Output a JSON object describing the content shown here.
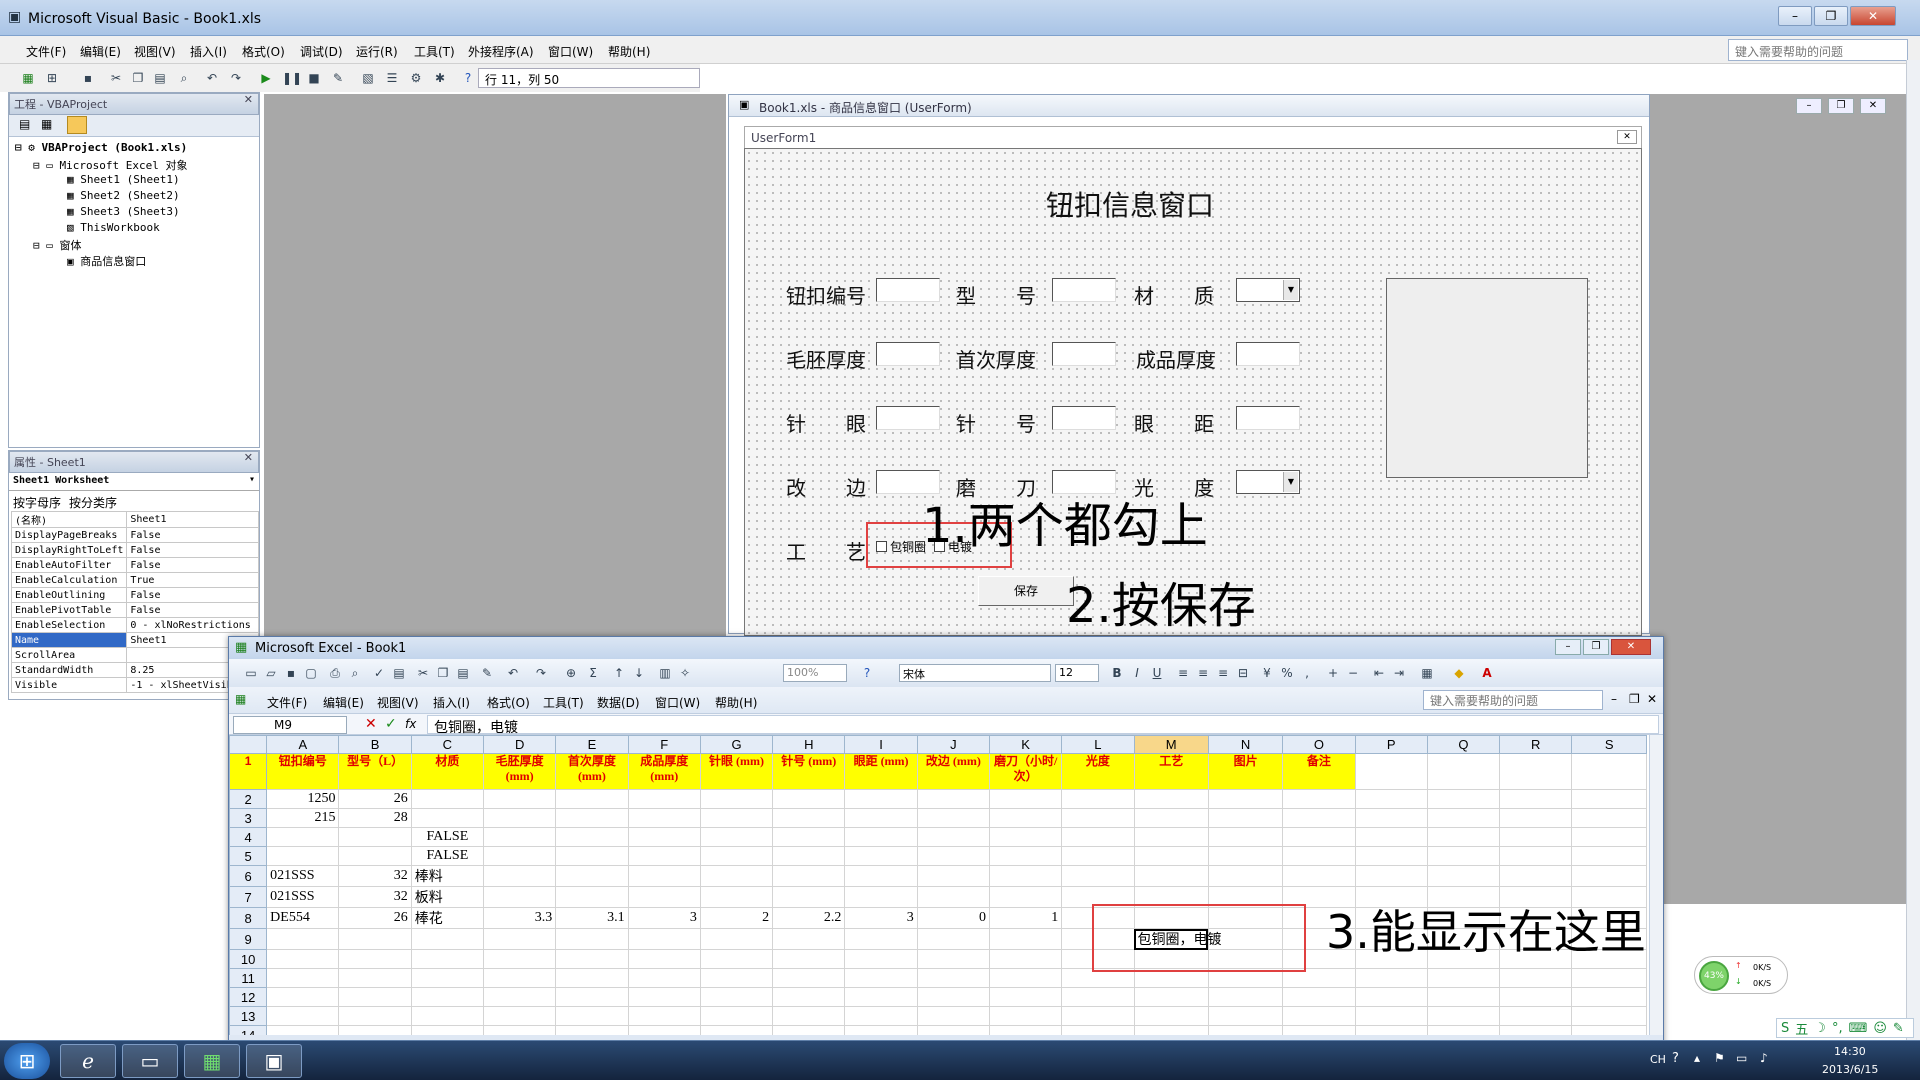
{
  "vbe": {
    "title": "Microsoft Visual Basic - Book1.xls",
    "menu": [
      "文件(F)",
      "编辑(E)",
      "视图(V)",
      "插入(I)",
      "格式(O)",
      "调试(D)",
      "运行(R)",
      "工具(T)",
      "外接程序(A)",
      "窗口(W)",
      "帮助(H)"
    ],
    "status": "行 11，列 50",
    "help_placeholder": "键入需要帮助的问题"
  },
  "project": {
    "title": "工程 - VBAProject",
    "tree": [
      "VBAProject (Book1.xls)",
      "Microsoft Excel 对象",
      "Sheet1 (Sheet1)",
      "Sheet2 (Sheet2)",
      "Sheet3 (Sheet3)",
      "ThisWorkbook",
      "窗体",
      "商品信息窗口"
    ]
  },
  "properties": {
    "title": "属性 - Sheet1",
    "object": "Sheet1 Worksheet",
    "tabs": [
      "按字母序",
      "按分类序"
    ],
    "rows": [
      [
        "(名称)",
        "Sheet1"
      ],
      [
        "DisplayPageBreaks",
        "False"
      ],
      [
        "DisplayRightToLeft",
        "False"
      ],
      [
        "EnableAutoFilter",
        "False"
      ],
      [
        "EnableCalculation",
        "True"
      ],
      [
        "EnableOutlining",
        "False"
      ],
      [
        "EnablePivotTable",
        "False"
      ],
      [
        "EnableSelection",
        "0 - xlNoRestrictions"
      ],
      [
        "Name",
        "Sheet1"
      ],
      [
        "ScrollArea",
        ""
      ],
      [
        "StandardWidth",
        "8.25"
      ],
      [
        "Visible",
        "-1 - xlSheetVisible"
      ]
    ]
  },
  "userform": {
    "window_title": "Book1.xls - 商品信息窗口 (UserForm)",
    "caption": "UserForm1",
    "heading": "钮扣信息窗口",
    "labels": [
      "钮扣编号",
      "型　　号",
      "材　　质",
      "毛胚厚度",
      "首次厚度",
      "成品厚度",
      "针　　眼",
      "针　　号",
      "眼　　距",
      "改　　边",
      "磨　　刀",
      "光　　度",
      "工　　艺"
    ],
    "chk1": "包铜圈",
    "chk2": "电镀",
    "save": "保存"
  },
  "annotations": {
    "a1": "1.两个都勾上",
    "a2": "2.按保存",
    "a3": "3.能显示在这里"
  },
  "excel": {
    "title": "Microsoft Excel - Book1",
    "menu": [
      "文件(F)",
      "编辑(E)",
      "视图(V)",
      "插入(I)",
      "格式(O)",
      "工具(T)",
      "数据(D)",
      "窗口(W)",
      "帮助(H)"
    ],
    "zoom": "100%",
    "font": "宋体",
    "size": "12",
    "help_placeholder": "键入需要帮助的问题",
    "name_box": "M9",
    "formula": "包铜圈，电镀",
    "cols": [
      "A",
      "B",
      "C",
      "D",
      "E",
      "F",
      "G",
      "H",
      "I",
      "J",
      "K",
      "L",
      "M",
      "N",
      "O",
      "P",
      "Q",
      "R",
      "S"
    ],
    "headers": [
      "钮扣编号",
      "型号（L）",
      "材质",
      "毛胚厚度(mm)",
      "首次厚度(mm)",
      "成品厚度(mm)",
      "针眼 (mm)",
      "针号 (mm)",
      "眼距 (mm)",
      "改边 (mm)",
      "磨刀（小时/次）",
      "光度",
      "工艺",
      "图片",
      "备注"
    ],
    "rows": [
      [
        "1250",
        "26",
        "",
        "",
        "",
        "",
        "",
        "",
        "",
        "",
        "",
        "",
        ""
      ],
      [
        "215",
        "28",
        "",
        "",
        "",
        "",
        "",
        "",
        "",
        "",
        "",
        "",
        ""
      ],
      [
        "",
        "",
        "FALSE",
        "",
        "",
        "",
        "",
        "",
        "",
        "",
        "",
        "",
        ""
      ],
      [
        "",
        "",
        "FALSE",
        "",
        "",
        "",
        "",
        "",
        "",
        "",
        "",
        "",
        ""
      ],
      [
        "021SSS",
        "32",
        "棒料",
        "",
        "",
        "",
        "",
        "",
        "",
        "",
        "",
        "",
        ""
      ],
      [
        "021SSS",
        "32",
        "板料",
        "",
        "",
        "",
        "",
        "",
        "",
        "",
        "",
        "",
        ""
      ],
      [
        "DE554",
        "26",
        "棒花",
        "3.3",
        "3.1",
        "3",
        "2",
        "2.2",
        "3",
        "0",
        "1",
        "",
        ""
      ],
      [
        "",
        "",
        "",
        "",
        "",
        "",
        "",
        "",
        "",
        "",
        "",
        "",
        "包铜圈，电镀"
      ],
      [
        "",
        "",
        "",
        "",
        "",
        "",
        "",
        "",
        "",
        "",
        "",
        "",
        ""
      ],
      [
        "",
        "",
        "",
        "",
        "",
        "",
        "",
        "",
        "",
        "",
        "",
        "",
        ""
      ],
      [
        "",
        "",
        "",
        "",
        "",
        "",
        "",
        "",
        "",
        "",
        "",
        "",
        ""
      ],
      [
        "",
        "",
        "",
        "",
        "",
        "",
        "",
        "",
        "",
        "",
        "",
        "",
        ""
      ],
      [
        "",
        "",
        "",
        "",
        "",
        "",
        "",
        "",
        "",
        "",
        "",
        "",
        ""
      ]
    ]
  },
  "netmeter": {
    "pct": "43%",
    "up": "0K/S",
    "down": "0K/S"
  },
  "tray": {
    "lang": "CH",
    "time": "14:30",
    "date": "2013/6/15"
  }
}
